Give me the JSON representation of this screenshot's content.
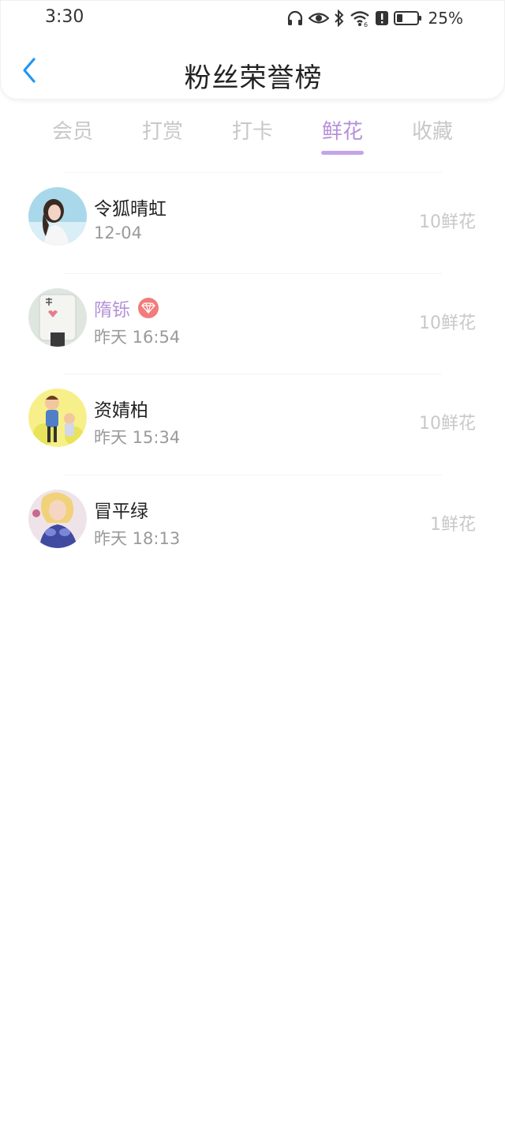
{
  "status_bar": {
    "time": "3:30",
    "battery_percent": "25%",
    "icons": [
      "headphones-icon",
      "eye-icon",
      "bluetooth-icon",
      "wifi-icon",
      "alert-icon",
      "battery-icon"
    ]
  },
  "header": {
    "title": "粉丝荣誉榜",
    "back_icon": "chevron-left-icon"
  },
  "tabs": [
    {
      "label": "会员",
      "active": false
    },
    {
      "label": "打赏",
      "active": false
    },
    {
      "label": "打卡",
      "active": false
    },
    {
      "label": "鲜花",
      "active": true
    },
    {
      "label": "收藏",
      "active": false
    }
  ],
  "fans": [
    {
      "name": "令狐晴虹",
      "time": "12-04",
      "amount": "10鲜花",
      "vip": false
    },
    {
      "name": "隋铄",
      "time": "昨天 16:54",
      "amount": "10鲜花",
      "vip": true
    },
    {
      "name": "资婧柏",
      "time": "昨天 15:34",
      "amount": "10鲜花",
      "vip": false
    },
    {
      "name": "冒平绿",
      "time": "昨天 18:13",
      "amount": "1鲜花",
      "vip": false
    }
  ],
  "colors": {
    "accent": "#b591d8",
    "back_arrow": "#2196f3",
    "vip_badge": "#f27b7b",
    "muted_text": "#c8c8c8"
  }
}
